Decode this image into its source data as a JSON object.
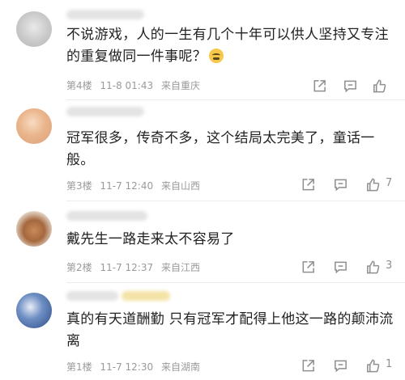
{
  "comments": [
    {
      "text": "不说游戏，人的一生有几个十年可以供人坚持又专注的重复做同一件事呢？",
      "emoji": "cry-emoji",
      "floor": "第4楼",
      "time": "11-8 01:43",
      "location": "来自重庆",
      "likes": ""
    },
    {
      "text": "冠军很多，传奇不多，这个结局太完美了，童话一般。",
      "floor": "第3楼",
      "time": "11-7 12:40",
      "location": "来自山西",
      "likes": "7"
    },
    {
      "text": "戴先生一路走来太不容易了",
      "floor": "第2楼",
      "time": "11-7 12:37",
      "location": "来自江西",
      "likes": "3"
    },
    {
      "text": "真的有天道酬勤 只有冠军才配得上他这一路的颠沛流离",
      "floor": "第1楼",
      "time": "11-7 12:30",
      "location": "来自湖南",
      "likes": "1"
    }
  ],
  "icons": {
    "share": "share-icon",
    "reply": "comment-icon",
    "like": "thumbs-up-icon"
  },
  "colors": {
    "text": "#222222",
    "meta": "#9a9a9a",
    "icon": "#8f8f8f"
  }
}
